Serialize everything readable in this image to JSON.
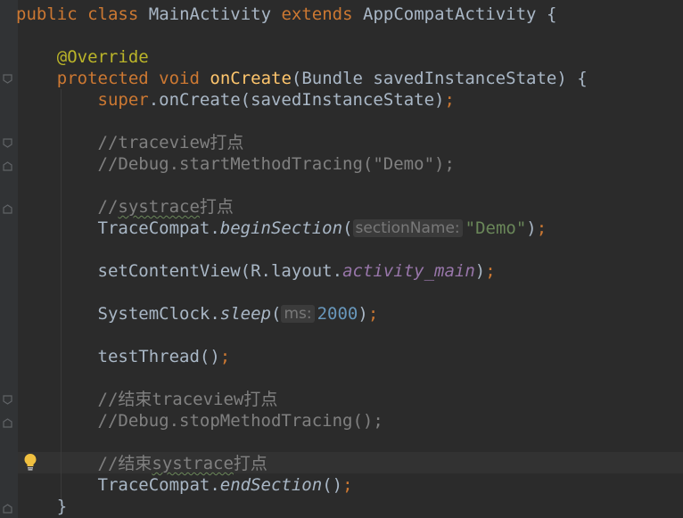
{
  "editor": {
    "lines": {
      "l1": {
        "kw1": "public",
        "kw2": "class",
        "name": "MainActivity",
        "kw3": "extends",
        "parent": "AppCompatActivity",
        "brace": "{"
      },
      "l3": {
        "annotation": "@Override"
      },
      "l4": {
        "kw1": "protected",
        "kw2": "void",
        "method": "onCreate",
        "params": "(Bundle savedInstanceState)",
        "brace": "{"
      },
      "l5": {
        "super": "super",
        "call": ".onCreate(savedInstanceState)",
        "semi": ";"
      },
      "l7": {
        "comment": "//traceview打点"
      },
      "l8": {
        "comment": "//Debug.startMethodTracing(\"Demo\");"
      },
      "l10": {
        "prefix": "//",
        "word": "systrace",
        "suffix": "打点"
      },
      "l11": {
        "cls": "TraceCompat.",
        "method": "beginSection",
        "open": "(",
        "hint": "sectionName:",
        "arg": "\"Demo\"",
        "close": ")",
        "semi": ";"
      },
      "l13": {
        "call": "setContentView(R.layout.",
        "field": "activity_main",
        "close": ")",
        "semi": ";"
      },
      "l15": {
        "cls": "SystemClock.",
        "method": "sleep",
        "open": "(",
        "hint": "ms:",
        "arg": "2000",
        "close": ")",
        "semi": ";"
      },
      "l17": {
        "call": "testThread()",
        "semi": ";"
      },
      "l19": {
        "comment": "//结束traceview打点"
      },
      "l20": {
        "comment": "//Debug.stopMethodTracing();"
      },
      "l22": {
        "prefix": "//结束",
        "word": "systrace",
        "suffix": "打点"
      },
      "l23": {
        "cls": "TraceCompat.",
        "method": "endSection",
        "call": "()",
        "semi": ";"
      },
      "l24": {
        "brace": "}"
      }
    }
  },
  "colors": {
    "background": "#2b2b2b",
    "keyword": "#cc7832",
    "method_decl": "#ffc66d",
    "annotation": "#bbb529",
    "comment": "#808080",
    "string": "#6a8759",
    "number": "#6897bb",
    "field": "#9876aa",
    "text": "#a9b7c6"
  },
  "icons": {
    "fold_markers": "fold-marker-icon",
    "intention": "lightbulb-icon"
  }
}
